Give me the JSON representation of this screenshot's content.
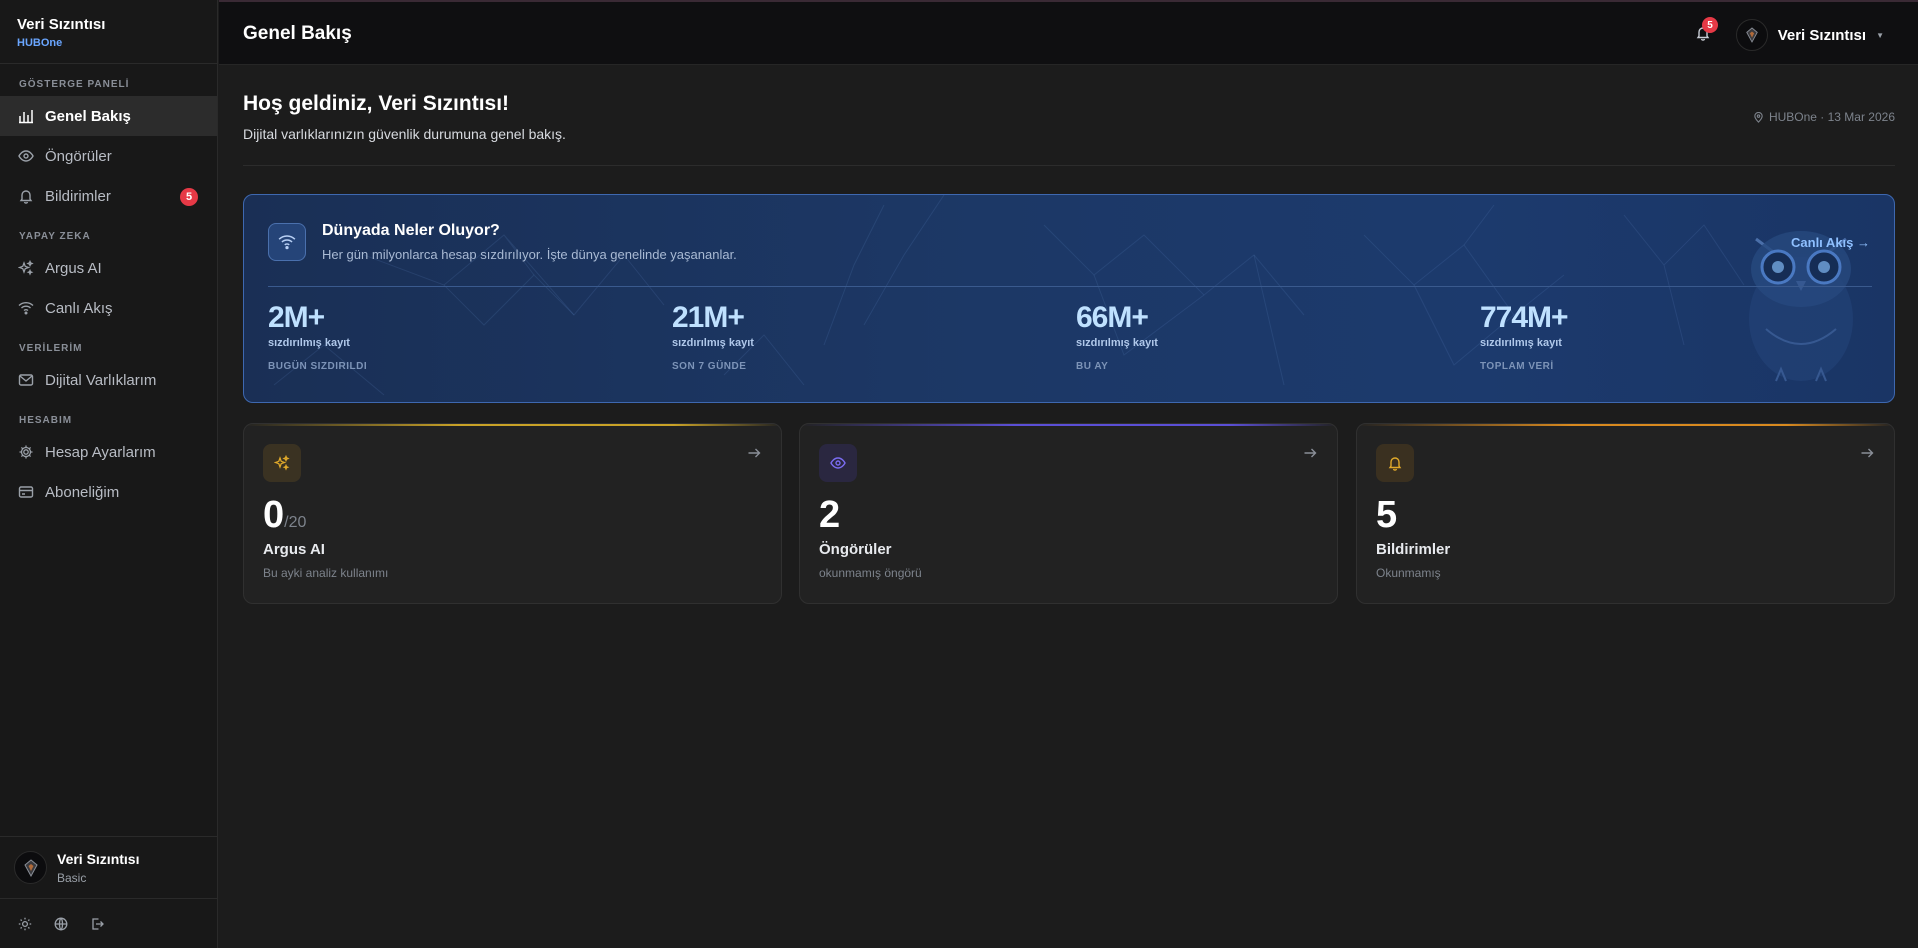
{
  "brand": {
    "name": "Veri Sızıntısı",
    "sub": "HUBOne"
  },
  "sidebar": {
    "sections": [
      {
        "label": "GÖSTERGE PANELİ"
      },
      {
        "label": "YAPAY ZEKA"
      },
      {
        "label": "VERİLERİM"
      },
      {
        "label": "HESABIM"
      }
    ],
    "items": [
      {
        "label": "Genel Bakış",
        "icon": "bar-chart-icon"
      },
      {
        "label": "Öngörüler",
        "icon": "eye-icon"
      },
      {
        "label": "Bildirimler",
        "icon": "bell-icon",
        "badge": "5"
      },
      {
        "label": "Argus AI",
        "icon": "sparkles-icon"
      },
      {
        "label": "Canlı Akış",
        "icon": "wifi-icon"
      },
      {
        "label": "Dijital Varlıklarım",
        "icon": "mail-icon"
      },
      {
        "label": "Hesap Ayarlarım",
        "icon": "gear-icon"
      },
      {
        "label": "Aboneliğim",
        "icon": "credit-card-icon"
      }
    ],
    "user": {
      "name": "Veri Sızıntısı",
      "plan": "Basic"
    },
    "tools": [
      "sun-icon",
      "globe-icon",
      "logout-icon"
    ]
  },
  "topbar": {
    "title": "Genel Bakış",
    "notif_count": "5",
    "user_name": "Veri Sızıntısı"
  },
  "welcome": {
    "title": "Hoş geldiniz, Veri Sızıntısı!",
    "subtitle": "Dijital varlıklarınızın güvenlik durumuna genel bakış.",
    "meta": "HUBOne · 13 Mar 2026"
  },
  "hero": {
    "title": "Dünyada Neler Oluyor?",
    "subtitle": "Her gün milyonlarca hesap sızdırılıyor. İşte dünya genelinde yaşananlar.",
    "link": "Canlı Akış →",
    "stats": [
      {
        "value": "2M+",
        "unit": "sızdırılmış kayıt",
        "period": "BUGÜN SIZDIRILDI"
      },
      {
        "value": "21M+",
        "unit": "sızdırılmış kayıt",
        "period": "SON 7 GÜNDE"
      },
      {
        "value": "66M+",
        "unit": "sızdırılmış kayıt",
        "period": "BU AY"
      },
      {
        "value": "774M+",
        "unit": "sızdırılmış kayıt",
        "period": "TOPLAM VERİ"
      }
    ]
  },
  "cards": [
    {
      "value": "0",
      "suffix": "/20",
      "title": "Argus AI",
      "desc": "Bu ayki analiz kullanımı",
      "accent": "#c9a227",
      "icon": "sparkles-icon"
    },
    {
      "value": "2",
      "suffix": "",
      "title": "Öngörüler",
      "desc": "okunmamış öngörü",
      "accent": "#5b4fd6",
      "icon": "eye-icon"
    },
    {
      "value": "5",
      "suffix": "",
      "title": "Bildirimler",
      "desc": "Okunmamış",
      "accent": "#d98a1f",
      "icon": "bell-icon"
    }
  ],
  "colors": {
    "accent_blue": "#6aa6ff",
    "badge_red": "#e63946",
    "hero_bg": "#1c3866"
  }
}
